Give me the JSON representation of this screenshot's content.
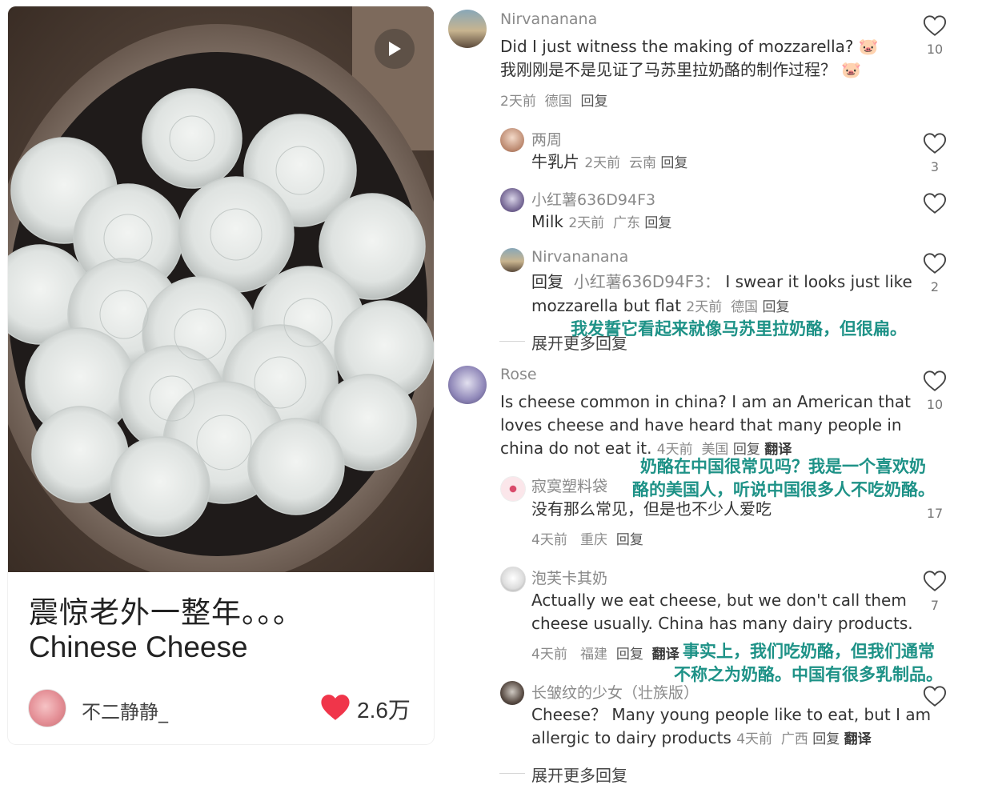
{
  "post": {
    "title_line1": "震惊老外一整年。。。",
    "title_line2": "Chinese Cheese",
    "author": "不二静静_",
    "likes": "2.6万"
  },
  "comments": {
    "c1": {
      "user": "Nirvananana",
      "text_en": "Did I just witness the making of mozzarella?",
      "text_zh": "我刚刚是不是见证了马苏里拉奶酪的制作过程？",
      "time": "2天前",
      "location": "德国",
      "reply": "回复",
      "likes": "10"
    },
    "r1": {
      "user": "两周",
      "text": "牛乳片",
      "time": "2天前",
      "location": "云南",
      "reply": "回复",
      "likes": "3"
    },
    "r2": {
      "user": "小红薯636D94F3",
      "text": "Milk",
      "time": "2天前",
      "location": "广东",
      "reply": "回复",
      "likes": ""
    },
    "r3": {
      "user": "Nirvananana",
      "reply_prefix": "回复",
      "reply_target": "小红薯636D94F3：",
      "text_a": "I swear it looks just like",
      "text_b": "mozzarella but flat",
      "time": "2天前",
      "location": "德国",
      "reply": "回复",
      "likes": "2",
      "overlay": "我发誓它看起来就像马苏里拉奶酪，但很扁。"
    },
    "expand1": "展开更多回复",
    "c2": {
      "user": "Rose",
      "line1": "Is cheese common in china? I am an American that",
      "line2": "loves cheese and have heard that many people in",
      "line3": "china do not eat it.",
      "time": "4天前",
      "location": "美国",
      "reply": "回复",
      "translate": "翻译",
      "likes": "10",
      "overlay1": "奶酪在中国很常见吗？我是一个喜欢奶",
      "overlay2": "酪的美国人，听说中国很多人不吃奶酪。"
    },
    "r4": {
      "user": "寂寞塑料袋",
      "text": "没有那么常见，但是也不少人爱吃",
      "time": "4天前",
      "location": "重庆",
      "reply": "回复",
      "likes": "17"
    },
    "r5": {
      "user": "泡芙卡其奶",
      "line1": "Actually we eat cheese, but we don't call them",
      "line2": "cheese usually. China has many dairy products.",
      "time": "4天前",
      "location": "福建",
      "reply": "回复",
      "translate": "翻译",
      "likes": "7",
      "overlay1": "事实上，我们吃奶酪，但我们通常",
      "overlay2": "不称之为奶酪。中国有很多乳制品。"
    },
    "r6": {
      "user": "长皱纹的少女（壮族版）",
      "line1": "Cheese？ Many young people like to eat, but I am",
      "line2": "allergic to dairy products",
      "time": "4天前",
      "location": "广西",
      "reply": "回复",
      "translate": "翻译",
      "likes": ""
    },
    "expand2": "展开更多回复"
  },
  "colors": {
    "accent_teal": "#1e9287",
    "like_red": "#f0354a"
  },
  "icons": [
    "play-icon",
    "heart-outline-icon",
    "heart-filled-icon",
    "avatar"
  ]
}
